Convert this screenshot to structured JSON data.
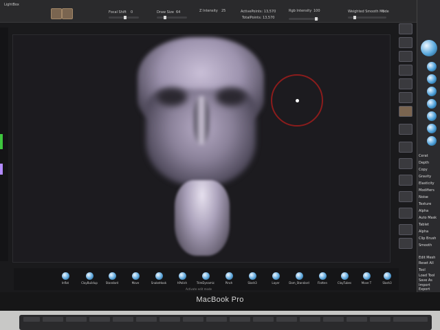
{
  "app": {
    "name": "ZBrush",
    "device_label": "MacBook Pro"
  },
  "topbar": {
    "lightbox_label": "LightBox",
    "focal_shift_label": "Focal Shift",
    "focal_shift_value": "0",
    "draw_size_label": "Draw Size",
    "draw_size_value": "64",
    "active_points_label": "ActivePoints: 13,570",
    "total_points_label": "TotalPoints: 13,570",
    "dynamic_label": "Dynamic",
    "z_intensity_label": "Z Intensity",
    "z_intensity_value": "25",
    "rgb_intensity_label": "Rgb Intensity",
    "rgb_intensity_value": "100",
    "weighted_label": "Weighted Smooth Mode",
    "weighted_value": "0"
  },
  "palette": {
    "items": [
      "Cerat",
      "Depth",
      "Copy",
      "Gravity",
      "Elasticity",
      "Modifiers",
      "Noise",
      "Texture",
      "Alpha",
      "Auto Mask",
      "Tablet",
      "Alpha",
      "Clip Brush",
      "Smooth"
    ],
    "bottom_items": [
      "Edit Mesh",
      "Reset All",
      "Tool",
      "Load Tool",
      "Save As",
      "Import",
      "Export"
    ]
  },
  "bottom_shelf": {
    "brushes": [
      "Inflat",
      "ClayBuildup",
      "Standard",
      "Move",
      "SnakeHook",
      "hPolish",
      "TrimDynamic",
      "Pinch",
      "Slash3",
      "Layer",
      "Dam_Standard",
      "Flatten",
      "ClayTubes",
      "Move T",
      "Slash3",
      "Planar"
    ],
    "status_text": "Activate edit mode"
  },
  "colors": {
    "brush_circle": "#8b1c1c",
    "accent_sphere": "#5aa9dd",
    "color_strip_green": "#3ec63e",
    "color_strip_purple": "#b38bff"
  },
  "icons": [
    "brush-sphere-icon",
    "draw-cursor-icon"
  ]
}
